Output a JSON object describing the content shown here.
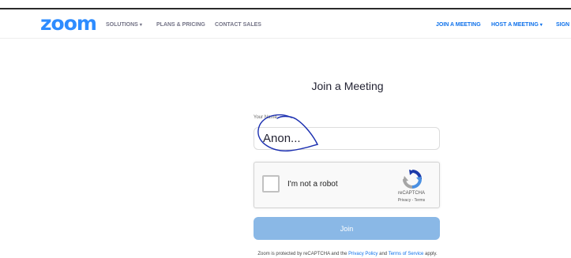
{
  "header": {
    "logo": "zoom",
    "nav_left": [
      {
        "label": "SOLUTIONS",
        "has_caret": true
      },
      {
        "label": "PLANS & PRICING"
      },
      {
        "label": "CONTACT SALES"
      }
    ],
    "nav_right": [
      {
        "label": "JOIN A MEETING"
      },
      {
        "label": "HOST A MEETING",
        "has_caret": true
      },
      {
        "label": "SIGN"
      }
    ]
  },
  "main": {
    "title": "Join a Meeting",
    "name_label": "Your Name",
    "name_value": "Anon...",
    "recaptcha": {
      "checkbox_label": "I'm not a robot",
      "brand": "reCAPTCHA",
      "links": "Privacy - Terms"
    },
    "join_label": "Join",
    "footer": {
      "prefix": "Zoom is protected by reCAPTCHA and the ",
      "privacy_link": "Privacy Policy",
      "middle": " and ",
      "terms_link": "Terms of Service",
      "suffix": " apply."
    }
  },
  "colors": {
    "brand_blue": "#2d8cff",
    "link_blue": "#0e71eb",
    "join_button": "#8ab8e6",
    "annotation_ink": "#1b2fb0"
  },
  "icons": {
    "caret": "chevron-down-icon",
    "recaptcha": "recaptcha-logo-icon"
  }
}
